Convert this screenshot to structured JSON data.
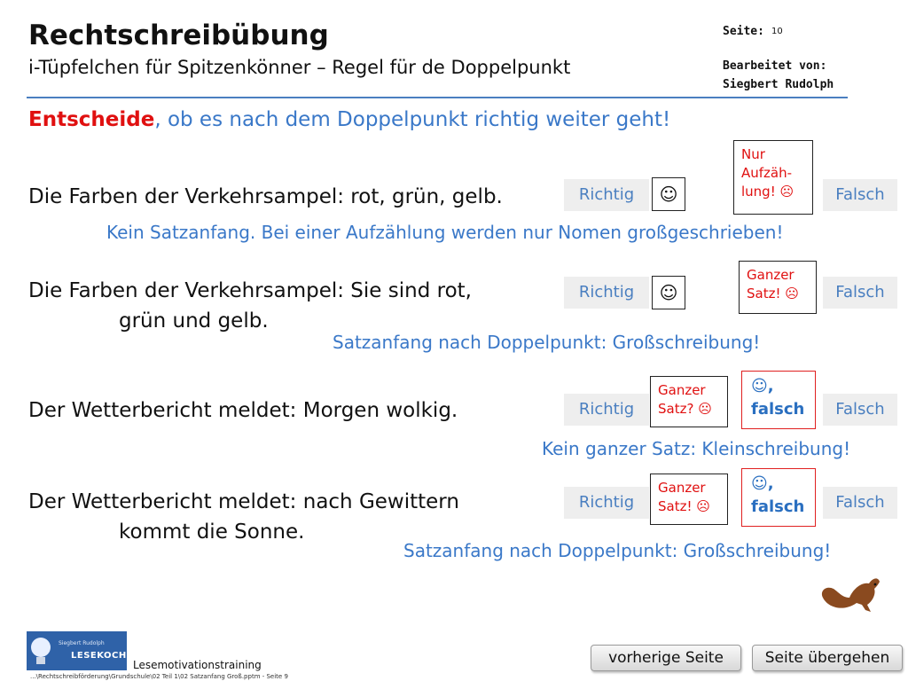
{
  "header": {
    "title": "Rechtschreibübung",
    "subtitle": "i-Tüpfelchen für Spitzenkönner – Regel für de Doppelpunkt",
    "page_label": "Seite:",
    "page_number": "10",
    "edited_label": "Bearbeitet von:",
    "author": "Siegbert Rudolph"
  },
  "instruction": {
    "highlight": "Entscheide",
    "rest": ", ob es nach dem Doppelpunkt richtig weiter geht!"
  },
  "exercises": [
    {
      "line1": "Die Farben der Verkehrsampel: rot, grün, gelb.",
      "line2": "",
      "richtig": "Richtig",
      "falsch": "Falsch",
      "richtig_mark": "☺",
      "note_lines": [
        "Nur",
        "Aufzäh-",
        "lung! ☹"
      ],
      "feedback": "Kein Satzanfang. Bei einer Aufzählung werden nur Nomen großgeschrieben!"
    },
    {
      "line1": "Die Farben der Verkehrsampel: Sie sind rot,",
      "line2": "grün und gelb.",
      "richtig": "Richtig",
      "falsch": "Falsch",
      "richtig_mark": "☺",
      "note_lines": [
        "Ganzer",
        "Satz! ☹"
      ],
      "feedback": "Satzanfang nach Doppelpunkt: Großschreibung!"
    },
    {
      "line1": "Der Wetterbericht meldet: Morgen wolkig.",
      "line2": "",
      "richtig": "Richtig",
      "falsch": "Falsch",
      "note_lines": [
        "Ganzer",
        "Satz? ☹"
      ],
      "result_lines": [
        "☺,",
        "falsch"
      ],
      "feedback": "Kein ganzer Satz: Kleinschreibung!"
    },
    {
      "line1": "Der Wetterbericht meldet: nach Gewittern",
      "line2": "kommt  die Sonne.",
      "richtig": "Richtig",
      "falsch": "Falsch",
      "note_lines": [
        "Ganzer",
        "Satz! ☹"
      ],
      "result_lines": [
        "☺,",
        "falsch"
      ],
      "feedback": "Satzanfang nach Doppelpunkt: Großschreibung!"
    }
  ],
  "navigation": {
    "prev": "vorherige Seite",
    "skip": "Seite übergehen"
  },
  "footer": {
    "logo_name": "Siegbert Rudolph",
    "logo_brand": "LESEKOCH",
    "program": "Lesemotivationstraining",
    "path": "...\\Rechtschreibförderung\\Grundschule\\02 Teil 1\\02 Satzanfang Groß.pptm - Seite 9"
  },
  "colors": {
    "accent_blue": "#3a78c8",
    "alert_red": "#e01010",
    "rule_blue": "#4a7fc0"
  }
}
